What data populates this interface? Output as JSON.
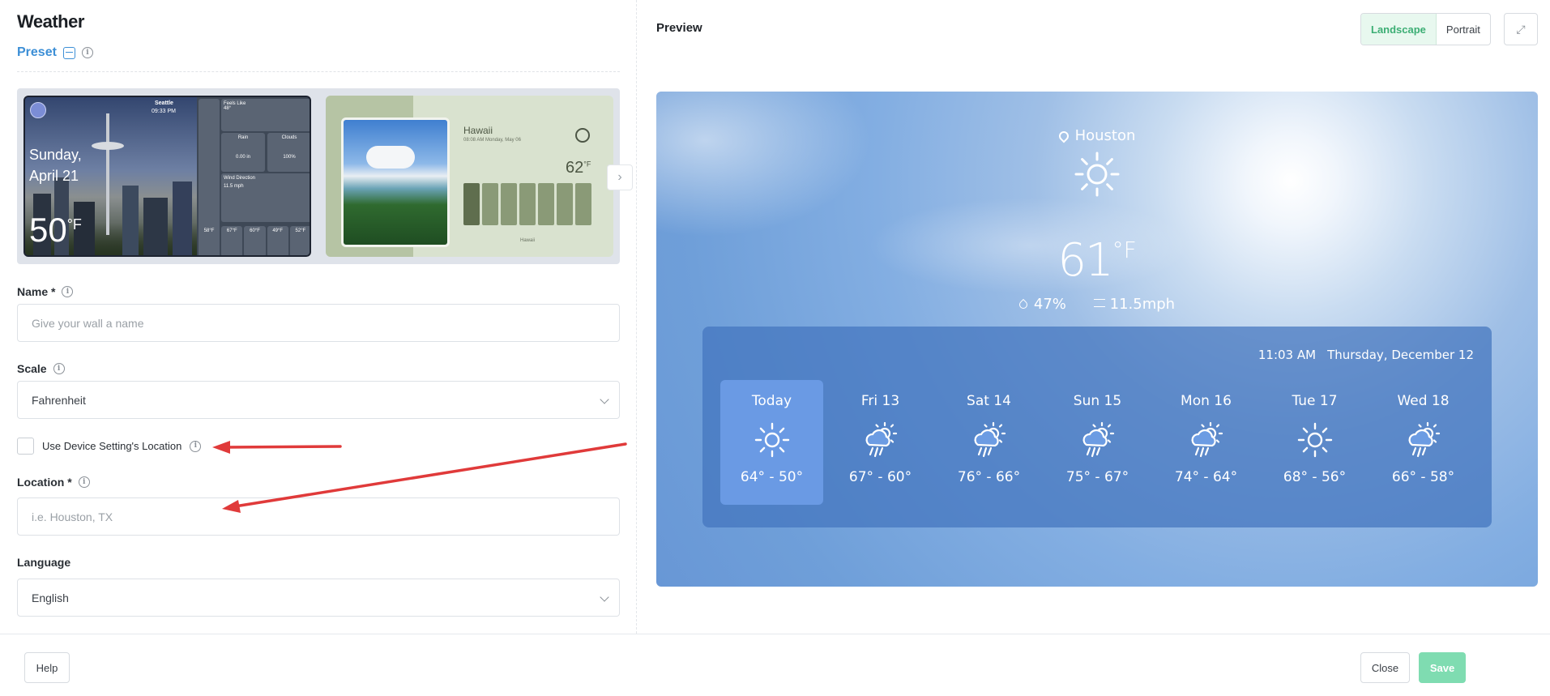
{
  "header": {
    "title": "Weather"
  },
  "preset": {
    "label": "Preset"
  },
  "thumb_seattle": {
    "city": "Seattle",
    "time": "09:33 PM",
    "day": "Sunday,",
    "date": "April 21",
    "temp": "50",
    "unit": "°F",
    "feels_like": "Feels Like",
    "feels_value": "48°",
    "rain_label": "Rain",
    "rain_value": "0.00 in",
    "clouds_label": "Clouds",
    "clouds_value": "100%",
    "wind_label": "Wind Direction",
    "wind_value": "11.5 mph",
    "days": [
      "58°F",
      "67°F",
      "60°F",
      "49°F",
      "52°F"
    ]
  },
  "thumb_hawaii": {
    "location": "Hawaii",
    "sub": "08:08 AM  Monday, May 06",
    "temp": "62",
    "unit": "°F",
    "footer": "Hawaii"
  },
  "form": {
    "name_label": "Name *",
    "name_placeholder": "Give your wall a name",
    "scale_label": "Scale",
    "scale_value": "Fahrenheit",
    "device_location_label": "Use Device Setting's Location",
    "location_label": "Location *",
    "location_placeholder": "i.e. Houston, TX",
    "language_label": "Language",
    "language_value": "English"
  },
  "preview": {
    "title": "Preview",
    "orientation": {
      "landscape": "Landscape",
      "portrait": "Portrait",
      "selected": "Landscape"
    },
    "location": "Houston",
    "temp": "61",
    "unit": "°F",
    "humidity": "47%",
    "wind": "11.5mph",
    "time": "11:03 AM",
    "date": "Thursday, December 12",
    "forecast": [
      {
        "day": "Today",
        "range": "64° - 50°",
        "icon": "sun-icon"
      },
      {
        "day": "Fri 13",
        "range": "67° - 60°",
        "icon": "sun-rain-icon"
      },
      {
        "day": "Sat 14",
        "range": "76° - 66°",
        "icon": "sun-rain-icon"
      },
      {
        "day": "Sun 15",
        "range": "75° - 67°",
        "icon": "sun-rain-icon"
      },
      {
        "day": "Mon 16",
        "range": "74° - 64°",
        "icon": "sun-rain-icon"
      },
      {
        "day": "Tue 17",
        "range": "68° - 56°",
        "icon": "sun-icon"
      },
      {
        "day": "Wed 18",
        "range": "66° - 58°",
        "icon": "sun-rain-icon"
      }
    ]
  },
  "footer": {
    "help": "Help",
    "close": "Close",
    "save": "Save"
  },
  "colors": {
    "accent_blue": "#3d8fd6",
    "accent_green": "#3cae74",
    "save_green": "#7fdcb1",
    "annotation_red": "#e03a3a"
  }
}
